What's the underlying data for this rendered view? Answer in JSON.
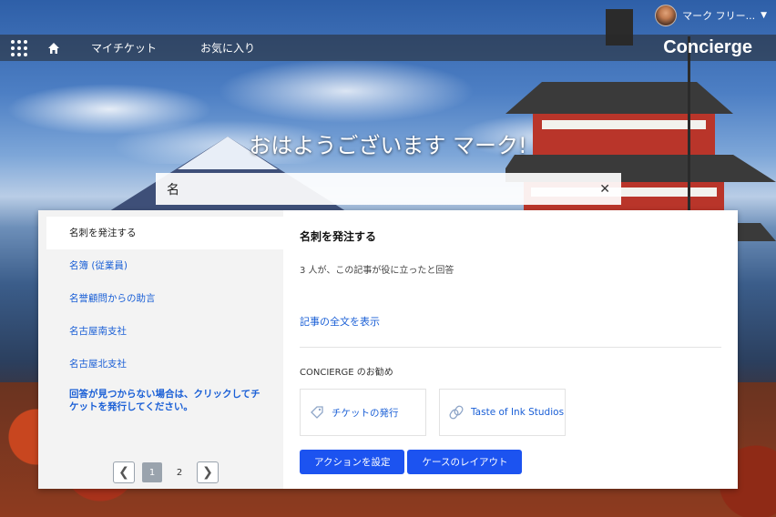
{
  "user": {
    "name": "マーク フリー..."
  },
  "nav": {
    "links": [
      "マイチケット",
      "お気に入り"
    ],
    "brand": "Concierge"
  },
  "greeting": "おはようございます マーク!",
  "search": {
    "value": "名"
  },
  "results": [
    "名刺を発注する",
    "名簿 (従業員)",
    "名誉顧問からの助言",
    "名古屋南支社",
    "名古屋北支社"
  ],
  "not_found": "回答が見つからない場合は、クリックしてチケットを発行してください。",
  "pager": {
    "pages": [
      "1",
      "2"
    ],
    "current": "1"
  },
  "article": {
    "title": "名刺を発注する",
    "meta": "3 人が、この記事が役に立ったと回答",
    "link": "記事の全文を表示"
  },
  "recommend": {
    "title": "CONCIERGE のお勧め",
    "cards": [
      {
        "label": "チケットの発行",
        "icon": "tag-icon"
      },
      {
        "label": "Taste of Ink Studios",
        "icon": "link-icon"
      }
    ]
  },
  "buttons": [
    "アクションを設定",
    "ケースのレイアウト"
  ]
}
